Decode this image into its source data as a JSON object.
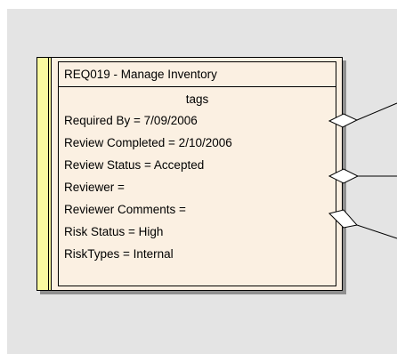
{
  "element": {
    "title": "REQ019 - Manage Inventory",
    "section_header": "tags",
    "tags": [
      "Required By = 7/09/2006",
      "Review Completed = 2/10/2006",
      "Review Status = Accepted",
      "Reviewer =",
      "Reviewer Comments =",
      "Risk Status = High",
      "RiskTypes = Internal"
    ]
  },
  "colors": {
    "canvas_background": "#e4e4e4",
    "element_fill": "#fbf0e2",
    "requirement_stripe": "#fafaa0",
    "border": "#000000",
    "shadow": "#8f8f8f"
  },
  "connectors": [
    {
      "name": "aggregation-connector-top",
      "end": "hollow-diamond"
    },
    {
      "name": "aggregation-connector-middle",
      "end": "hollow-diamond"
    },
    {
      "name": "aggregation-connector-bottom",
      "end": "hollow-diamond"
    }
  ]
}
